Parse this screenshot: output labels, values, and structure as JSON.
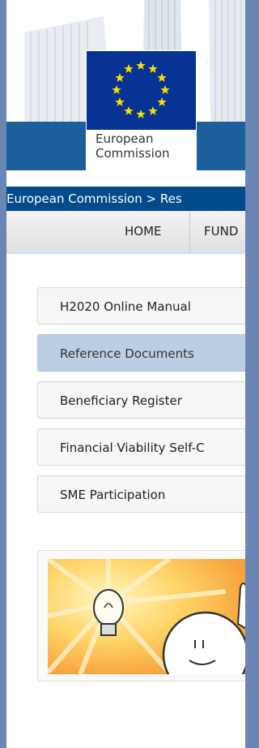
{
  "header": {
    "logo_line1": "European",
    "logo_line2": "Commission"
  },
  "breadcrumb": {
    "text": "European Commission > Res"
  },
  "topnav": {
    "items": [
      "HOME",
      "FUND"
    ]
  },
  "sidebar": {
    "items": [
      {
        "label": "H2020 Online Manual",
        "active": false
      },
      {
        "label": "Reference Documents",
        "active": true
      },
      {
        "label": "Beneficiary Register",
        "active": false
      },
      {
        "label": "Financial Viability Self-C",
        "active": false
      },
      {
        "label": "SME Participation",
        "active": false
      }
    ]
  },
  "colors": {
    "frame": "#6b86b4",
    "breadcrumb_bg": "#024b8b",
    "active_item": "#bccee4",
    "flag_blue": "#073494",
    "star_yellow": "#ffdd00"
  }
}
